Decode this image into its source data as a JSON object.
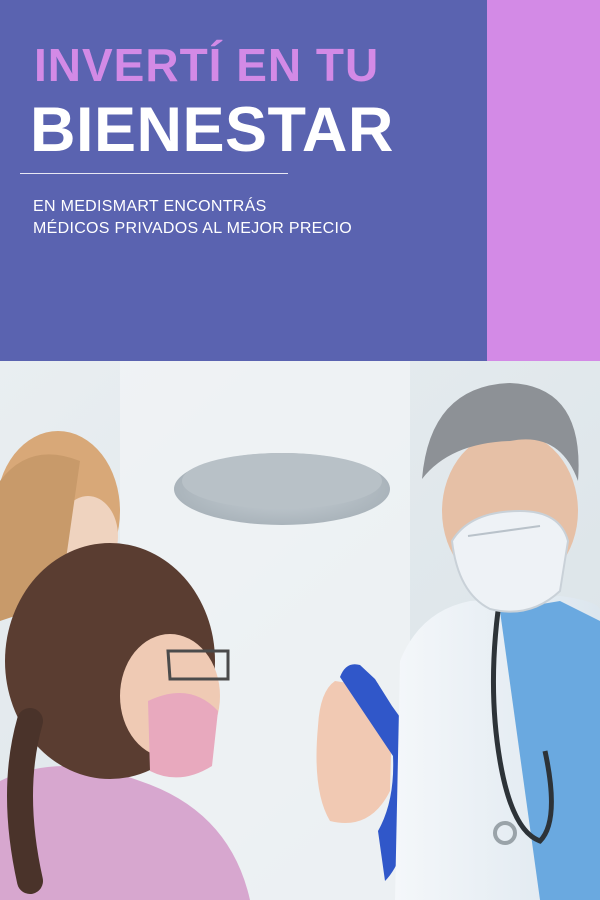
{
  "headline": {
    "line1": "INVERTÍ EN TU",
    "line2": "BIENESTAR"
  },
  "subtitle": {
    "line1": "EN MEDISMART ENCONTRÁS",
    "line2": "MÉDICOS PRIVADOS AL MEJOR PRECIO"
  },
  "colors": {
    "header_background": "#5a63b0",
    "accent": "#d38ae6",
    "text_primary": "#ffffff"
  },
  "photo": {
    "icon": "doctor-patient-high-five-photo"
  }
}
